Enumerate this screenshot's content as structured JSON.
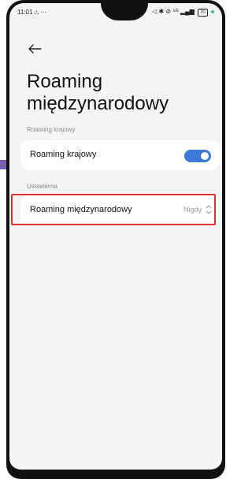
{
  "status": {
    "time": "11:01",
    "left_icons": "⛬ ···",
    "right_icons": "◁ ✱ ⊘ ⁵ᴳ",
    "battery": "70"
  },
  "header": {
    "title": "Roaming międzynarodowy"
  },
  "sections": [
    {
      "label": "Roaming krajowy",
      "items": [
        {
          "label": "Roaming krajowy",
          "toggle_on": true
        }
      ]
    },
    {
      "label": "Ustawienia",
      "items": [
        {
          "label": "Roaming międzynarodowy",
          "value": "Nigdy"
        }
      ]
    }
  ],
  "colors": {
    "toggle_on": "#3b78d8",
    "highlight": "#e0312f",
    "accent": "#7a5fb0"
  }
}
